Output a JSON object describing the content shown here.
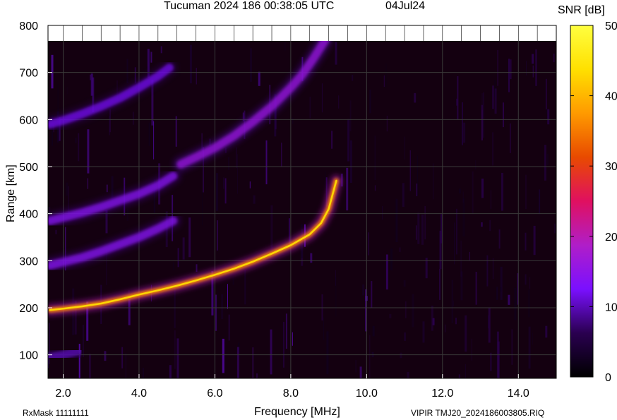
{
  "header": {
    "title": "Tucuman 2024 186 00:38:05 UTC",
    "date": "04Jul24"
  },
  "footer": {
    "rxmask": "RxMask 11111111",
    "fileinfo": "VIPIR  TMJ20_2024186003805.RIQ"
  },
  "colorbar": {
    "title": "SNR [dB]",
    "range": [
      0,
      50
    ],
    "ticks": [
      "0",
      "10",
      "20",
      "30",
      "40",
      "50"
    ],
    "colormap": [
      "#000000",
      "#2a0050",
      "#7a10ff",
      "#b01ec8",
      "#e01060",
      "#e84a00",
      "#ff9a00",
      "#ffe000",
      "#ffff40"
    ]
  },
  "chart_data": {
    "type": "heatmap",
    "xlabel": "Frequency [MHz]",
    "ylabel": "Range [km]",
    "xlim": [
      1.6,
      15.0
    ],
    "ylim": [
      50,
      800
    ],
    "xticks": [
      "2.0",
      "4.0",
      "6.0",
      "8.0",
      "10.0",
      "12.0",
      "14.0"
    ],
    "yticks": [
      "100",
      "200",
      "300",
      "400",
      "500",
      "600",
      "700",
      "800"
    ],
    "grid": true,
    "background_color": "#140010",
    "traces": [
      {
        "name": "",
        "snr_db": 36,
        "points": [
          [
            1.65,
            195
          ],
          [
            2.0,
            198
          ],
          [
            2.5,
            203
          ],
          [
            3.0,
            209
          ],
          [
            3.5,
            218
          ],
          [
            4.0,
            228
          ],
          [
            4.5,
            237
          ],
          [
            5.0,
            247
          ],
          [
            5.5,
            258
          ],
          [
            6.0,
            270
          ],
          [
            6.5,
            283
          ],
          [
            7.0,
            298
          ],
          [
            7.5,
            315
          ],
          [
            8.0,
            333
          ],
          [
            8.5,
            356
          ],
          [
            8.8,
            380
          ],
          [
            9.0,
            410
          ],
          [
            9.1,
            440
          ],
          [
            9.2,
            470
          ]
        ]
      },
      {
        "name": "",
        "snr_db": 14,
        "points": [
          [
            1.65,
            290
          ],
          [
            2.0,
            297
          ],
          [
            2.5,
            307
          ],
          [
            3.0,
            320
          ],
          [
            3.5,
            335
          ],
          [
            4.0,
            350
          ],
          [
            4.5,
            368
          ],
          [
            4.9,
            385
          ]
        ]
      },
      {
        "name": "",
        "snr_db": 14,
        "points": [
          [
            1.65,
            385
          ],
          [
            2.0,
            392
          ],
          [
            2.5,
            402
          ],
          [
            3.0,
            414
          ],
          [
            3.5,
            428
          ],
          [
            4.0,
            442
          ],
          [
            4.5,
            460
          ],
          [
            4.9,
            480
          ]
        ]
      },
      {
        "name": "",
        "snr_db": 12,
        "points": [
          [
            1.65,
            590
          ],
          [
            2.0,
            598
          ],
          [
            2.5,
            612
          ],
          [
            3.0,
            628
          ],
          [
            3.5,
            646
          ],
          [
            4.0,
            668
          ],
          [
            4.5,
            692
          ],
          [
            4.8,
            710
          ]
        ]
      },
      {
        "name": "",
        "snr_db": 16,
        "points": [
          [
            5.1,
            505
          ],
          [
            5.5,
            520
          ],
          [
            6.0,
            540
          ],
          [
            6.5,
            565
          ],
          [
            7.0,
            595
          ],
          [
            7.5,
            628
          ],
          [
            8.0,
            668
          ],
          [
            8.3,
            695
          ],
          [
            8.6,
            730
          ],
          [
            8.9,
            768
          ]
        ]
      },
      {
        "name": "",
        "snr_db": 10,
        "points": [
          [
            1.65,
            95
          ],
          [
            2.0,
            100
          ],
          [
            2.4,
            108
          ]
        ]
      }
    ]
  }
}
